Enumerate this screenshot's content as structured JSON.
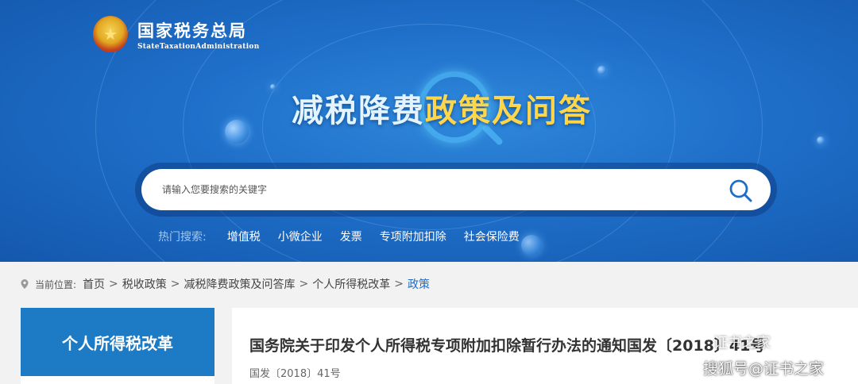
{
  "header": {
    "org_name_cn": "国家税务总局",
    "org_name_en": "StateTaxationAdministration"
  },
  "hero": {
    "title_part1": "减税降费",
    "title_part2": "政策及问答"
  },
  "search": {
    "placeholder": "请输入您要搜索的关键字",
    "value": ""
  },
  "hot_search": {
    "label": "热门搜索:",
    "items": [
      "增值税",
      "小微企业",
      "发票",
      "专项附加扣除",
      "社会保险费"
    ]
  },
  "breadcrumb": {
    "current_position_label": "当前位置:",
    "items": [
      "首页",
      "税收政策",
      "减税降费政策及问答库",
      "个人所得税改革",
      "政策"
    ],
    "separator": ">"
  },
  "sidebar": {
    "heading": "个人所得税改革"
  },
  "article": {
    "title": "国务院关于印发个人所得税专项附加扣除暂行办法的通知国发〔2018〕41号",
    "document_number": "国发〔2018〕41号"
  },
  "watermark": {
    "text": "搜狐号@证书之家",
    "wechat_name": "证书之家"
  },
  "colors": {
    "banner_blue": "#1e6ec8",
    "title_yellow": "#ffd64a",
    "sidebar_blue": "#1c7bc4",
    "breadcrumb_current": "#1e6ec8"
  }
}
